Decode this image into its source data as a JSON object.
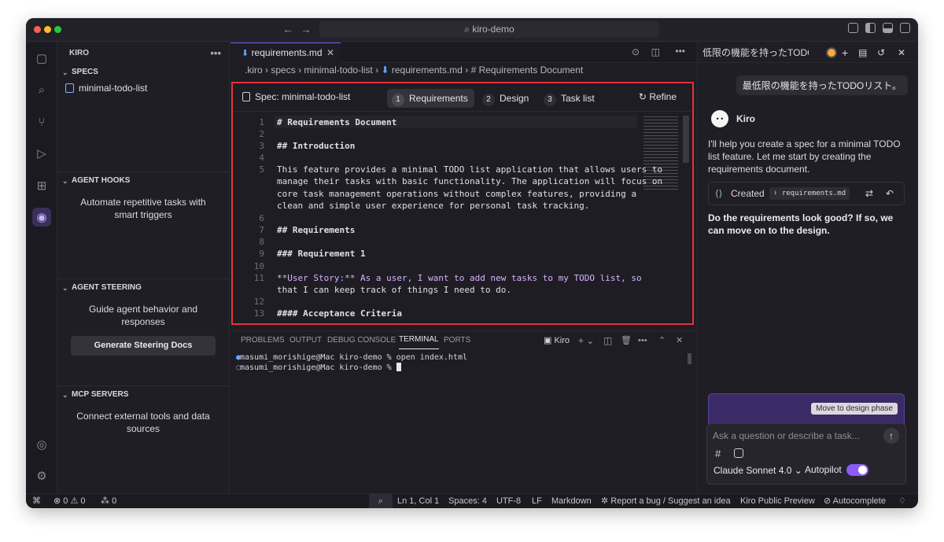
{
  "titlebar": {
    "search_text": "kiro-demo"
  },
  "sidebar": {
    "title": "KIRO",
    "specs": {
      "title": "SPECS",
      "items": [
        {
          "label": "minimal-todo-list"
        }
      ]
    },
    "hooks": {
      "title": "AGENT HOOKS",
      "description": "Automate repetitive tasks with smart triggers"
    },
    "steering": {
      "title": "AGENT STEERING",
      "description": "Guide agent behavior and responses",
      "button": "Generate Steering Docs"
    },
    "mcp": {
      "title": "MCP SERVERS",
      "description": "Connect external tools and data sources"
    }
  },
  "editor": {
    "tab_label": "requirements.md",
    "breadcrumb": [
      ".kiro",
      "specs",
      "minimal-todo-list",
      "requirements.md",
      "# Requirements Document"
    ],
    "spec_title": "Spec: minimal-todo-list",
    "steps": [
      {
        "num": "1",
        "label": "Requirements",
        "active": true
      },
      {
        "num": "2",
        "label": "Design",
        "active": false
      },
      {
        "num": "3",
        "label": "Task list",
        "active": false
      }
    ],
    "refine": "Refine",
    "lines": [
      {
        "n": "1",
        "text": "# Requirements Document"
      },
      {
        "n": "2",
        "text": ""
      },
      {
        "n": "3",
        "text": "## Introduction"
      },
      {
        "n": "4",
        "text": ""
      },
      {
        "n": "5",
        "text": "This feature provides a minimal TODO list application that allows users to"
      },
      {
        "n": "",
        "text": "manage their tasks with basic functionality. The application will focus on"
      },
      {
        "n": "",
        "text": "core task management operations without complex features, providing a"
      },
      {
        "n": "",
        "text": "clean and simple user experience for personal task tracking."
      },
      {
        "n": "6",
        "text": ""
      },
      {
        "n": "7",
        "text": "## Requirements"
      },
      {
        "n": "8",
        "text": ""
      },
      {
        "n": "9",
        "text": "### Requirement 1"
      },
      {
        "n": "10",
        "text": ""
      },
      {
        "n": "11",
        "text": "**User Story:** As a user, I want to add new tasks to my TODO list, so"
      },
      {
        "n": "",
        "text": "that I can keep track of things I need to do."
      },
      {
        "n": "12",
        "text": ""
      },
      {
        "n": "13",
        "text": "#### Acceptance Criteria"
      }
    ]
  },
  "panel": {
    "tabs": [
      "PROBLEMS",
      "OUTPUT",
      "DEBUG CONSOLE",
      "TERMINAL",
      "PORTS"
    ],
    "terminal_name": "Kiro",
    "lines": [
      "masumi_morishige@Mac kiro-demo % open index.html",
      "masumi_morishige@Mac kiro-demo % "
    ]
  },
  "chat": {
    "tab_title": "低限の機能を持ったTODO...",
    "user_message": "最低限の機能を持ったTODOリスト。",
    "agent_name": "Kiro",
    "agent_message": "I'll help you create a spec for a minimal TODO list feature. Let me start by creating the requirements document.",
    "created_label": "Created",
    "created_file": "requirements.md",
    "question": "Do the requirements look good? If so, we can move on to the design.",
    "move_button": "Move to design phase",
    "input_placeholder": "Ask a question or describe a task...",
    "model": "Claude Sonnet 4.0",
    "autopilot": "Autopilot"
  },
  "status": {
    "errors": "0",
    "warnings": "0",
    "ports": "0",
    "position": "Ln 1, Col 1",
    "spaces": "Spaces: 4",
    "encoding": "UTF-8",
    "eol": "LF",
    "language": "Markdown",
    "report": "Report a bug / Suggest an idea",
    "preview": "Kiro Public Preview",
    "autocomplete": "Autocomplete"
  },
  "colors": {
    "accent": "#8b5cf6",
    "highlight_border": "#e6313a"
  }
}
